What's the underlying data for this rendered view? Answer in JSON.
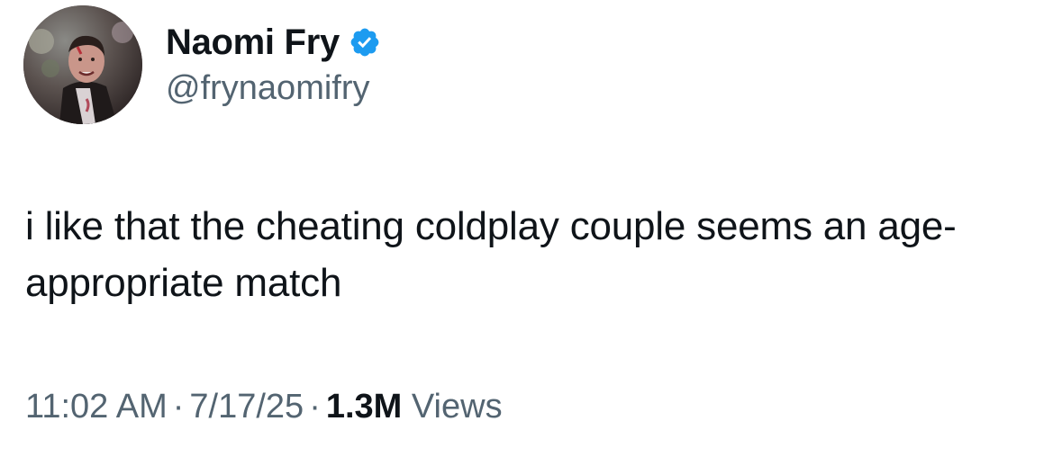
{
  "author": {
    "display_name": "Naomi Fry",
    "handle": "@frynaomifry",
    "avatar_icon": "profile-photo",
    "verified_icon": "verified-badge-icon",
    "verified_color": "#1d9bf0"
  },
  "tweet": {
    "text": "i like that the cheating coldplay couple seems an age-appropriate match"
  },
  "meta": {
    "time": "11:02 AM",
    "separator": "·",
    "date": "7/17/25",
    "views_count": "1.3M",
    "views_label": "Views"
  }
}
